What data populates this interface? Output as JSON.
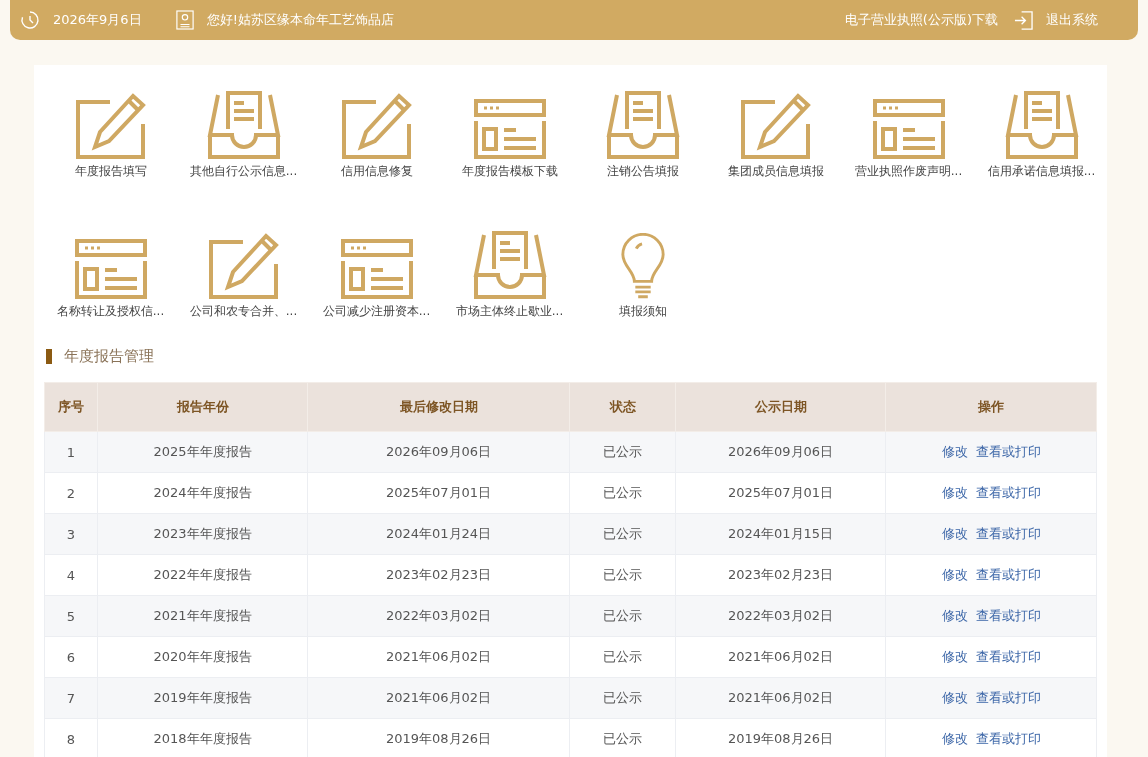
{
  "header": {
    "date": "2026年9月6日",
    "greeting": "您好!姑苏区缘本命年工艺饰品店",
    "license_link": "电子营业执照(公示版)下载",
    "logout": "退出系统"
  },
  "shortcuts": [
    {
      "label": "年度报告填写",
      "kind": "pencil"
    },
    {
      "label": "其他自行公示信息...",
      "kind": "tray"
    },
    {
      "label": "信用信息修复",
      "kind": "pencil"
    },
    {
      "label": "年度报告模板下载",
      "kind": "window"
    },
    {
      "label": "注销公告填报",
      "kind": "tray"
    },
    {
      "label": "集团成员信息填报",
      "kind": "pencil"
    },
    {
      "label": "营业执照作废声明...",
      "kind": "window"
    },
    {
      "label": "信用承诺信息填报...",
      "kind": "tray"
    },
    {
      "label": "名称转让及授权信...",
      "kind": "window"
    },
    {
      "label": "公司和农专合并、...",
      "kind": "pencil"
    },
    {
      "label": "公司减少注册资本...",
      "kind": "window"
    },
    {
      "label": "市场主体终止歇业...",
      "kind": "tray"
    },
    {
      "label": "填报须知",
      "kind": "bulb"
    }
  ],
  "section_title": "年度报告管理",
  "table": {
    "columns": [
      "序号",
      "报告年份",
      "最后修改日期",
      "状态",
      "公示日期",
      "操作"
    ],
    "rows": [
      {
        "index": "1",
        "year": "2025年年度报告",
        "modified": "2026年09月06日",
        "status": "已公示",
        "published": "2026年09月06日",
        "actions": [
          "修改",
          "查看或打印"
        ]
      },
      {
        "index": "2",
        "year": "2024年年度报告",
        "modified": "2025年07月01日",
        "status": "已公示",
        "published": "2025年07月01日",
        "actions": [
          "修改",
          "查看或打印"
        ]
      },
      {
        "index": "3",
        "year": "2023年年度报告",
        "modified": "2024年01月24日",
        "status": "已公示",
        "published": "2024年01月15日",
        "actions": [
          "修改",
          "查看或打印"
        ]
      },
      {
        "index": "4",
        "year": "2022年年度报告",
        "modified": "2023年02月23日",
        "status": "已公示",
        "published": "2023年02月23日",
        "actions": [
          "修改",
          "查看或打印"
        ]
      },
      {
        "index": "5",
        "year": "2021年年度报告",
        "modified": "2022年03月02日",
        "status": "已公示",
        "published": "2022年03月02日",
        "actions": [
          "修改",
          "查看或打印"
        ]
      },
      {
        "index": "6",
        "year": "2020年年度报告",
        "modified": "2021年06月02日",
        "status": "已公示",
        "published": "2021年06月02日",
        "actions": [
          "修改",
          "查看或打印"
        ]
      },
      {
        "index": "7",
        "year": "2019年年度报告",
        "modified": "2021年06月02日",
        "status": "已公示",
        "published": "2021年06月02日",
        "actions": [
          "修改",
          "查看或打印"
        ]
      },
      {
        "index": "8",
        "year": "2018年年度报告",
        "modified": "2019年08月26日",
        "status": "已公示",
        "published": "2019年08月26日",
        "actions": [
          "修改",
          "查看或打印"
        ]
      }
    ]
  }
}
